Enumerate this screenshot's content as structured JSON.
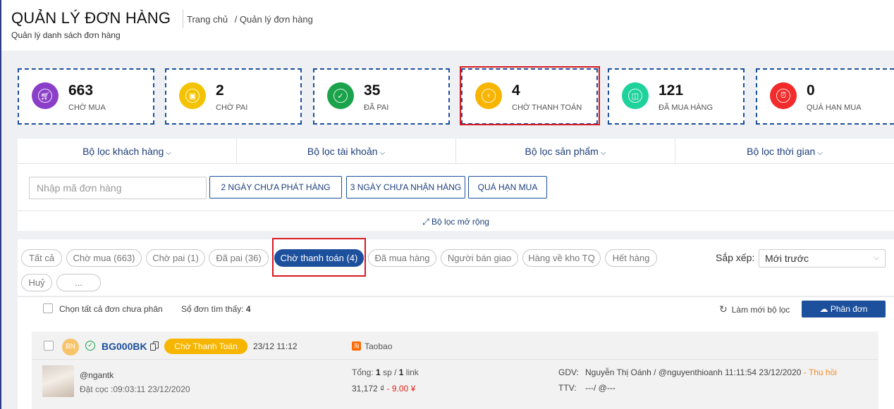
{
  "header": {
    "title": "QUẢN LÝ ĐƠN HÀNG",
    "subtitle": "Quản lý danh sách đơn hàng",
    "breadcrumb": [
      "Trang chủ",
      "/ Quản lý đơn hàng"
    ]
  },
  "stats": [
    {
      "value": "663",
      "label": "CHỜ MUA",
      "color": "#8b3fc9",
      "icon": "cart-icon"
    },
    {
      "value": "2",
      "label": "CHỜ PAI",
      "color": "#f3c200",
      "icon": "bag-icon"
    },
    {
      "value": "35",
      "label": "ĐÃ PAI",
      "color": "#1aa34a",
      "icon": "check-icon"
    },
    {
      "value": "4",
      "label": "CHỜ THANH TOÁN",
      "color": "#f7b500",
      "icon": "lightbulb-icon"
    },
    {
      "value": "121",
      "label": "ĐÃ MUA HÀNG",
      "color": "#1fd19a",
      "icon": "shopping-bag-icon"
    },
    {
      "value": "0",
      "label": "QUÁ HẠN MUA",
      "color": "#f22b2b",
      "icon": "alarm-icon"
    }
  ],
  "filters": {
    "dropdowns": [
      "Bộ lọc khách hàng",
      "Bộ lọc tài khoản",
      "Bộ lọc sản phẩm",
      "Bộ lọc thời gian"
    ],
    "order_placeholder": "Nhập mã đơn hàng",
    "quick": [
      "2 NGÀY CHƯA PHÁT HÀNG",
      "3 NGÀY CHƯA NHẬN HÀNG",
      "QUÁ HẠN MUA"
    ],
    "expand": "Bộ lọc mở rộng"
  },
  "tabs": [
    {
      "label": "Tất cả"
    },
    {
      "label": "Chờ mua (663)"
    },
    {
      "label": "Chờ pai (1)"
    },
    {
      "label": "Đã pai (36)"
    },
    {
      "label": "Chờ thanh toán (4)",
      "active": true
    },
    {
      "label": "Đã mua hàng"
    },
    {
      "label": "Người bán giao"
    },
    {
      "label": "Hàng về kho TQ"
    },
    {
      "label": "Hết hàng"
    },
    {
      "label": "Huỷ"
    },
    {
      "label": "..."
    }
  ],
  "sort": {
    "label": "Sắp xếp:",
    "value": "Mới trước"
  },
  "toolbar": {
    "select_all": "Chọn tất cả đơn chưa phân",
    "found_label": "Số đơn tìm thấy:",
    "found_count": "4",
    "refresh": "Làm mới bộ lọc",
    "split": "Phân đơn"
  },
  "order": {
    "avatar": "BN",
    "code": "BG000BK",
    "status": "Chờ Thanh Toán",
    "time": "23/12 11:12",
    "shop": "Taobao",
    "buyer": "@ngantk",
    "deposit": "Đặt cọc :09:03:11 23/12/2020",
    "total_label": "Tổng:",
    "qty": "1",
    "sp": "sp /",
    "links": "1",
    "link_word": "link",
    "price": "31,172 ₫",
    "price_cny": "- 9.00 ¥",
    "gdv_label": "GDV:",
    "gdv_value": "Nguyễn Thị Oánh / @nguyenthioanh 11:11:54 23/12/2020",
    "gdv_action": "- Thu hồi",
    "ttv_label": "TTV:",
    "ttv_value": "---/ @---"
  }
}
